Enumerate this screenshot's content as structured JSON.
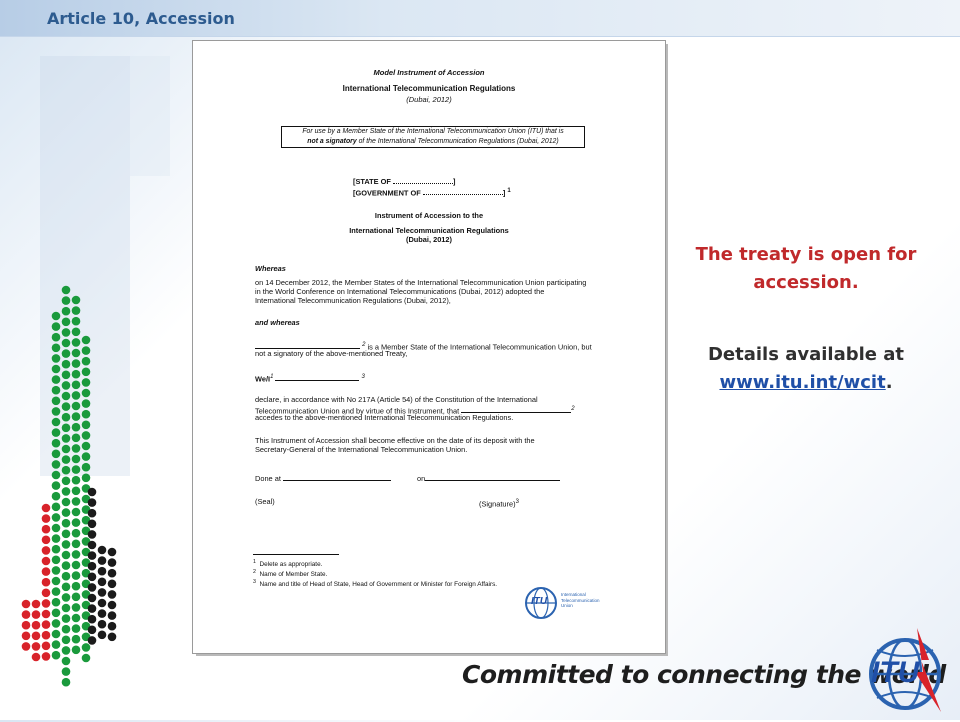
{
  "slide": {
    "title": "Article 10, Accession"
  },
  "document": {
    "heading1": "Model Instrument of Accession",
    "heading2": "International Telecommunication Regulations",
    "heading2_sub": "(Dubai, 2012)",
    "box_line1": "For use by a Member State of the International Telecommunication Union (ITU) that is",
    "box_line2_bold": "not a signatory",
    "box_line2_rest": " of the International Telecommunication Regulations (Dubai, 2012)",
    "state_of": "[STATE OF",
    "state_of_end": "]",
    "government_of": "[GOVERNMENT OF",
    "government_of_end": "]",
    "sup1": "1",
    "instrument_title1": "Instrument of Accession to the",
    "instrument_title2": "International Telecommunication Regulations",
    "instrument_title3": "(Dubai, 2012)",
    "whereas": "Whereas",
    "whereas_text1": "on 14 December 2012, the Member States of the International Telecommunication Union participating",
    "whereas_text2": "in the World Conference on International Telecommunications (Dubai, 2012) adopted  the",
    "whereas_text3": "International Telecommunication Regulations (Dubai, 2012),",
    "and_whereas": "and whereas",
    "member_state_sup": "2",
    "member_state_text": " is a Member State of the International Telecommunication Union, but",
    "member_state_text2": "not a signatory of the above-mentioned Treaty,",
    "we_i": "We/I",
    "we_i_sup": "1",
    "we_i_sup3": "3",
    "declare1": "declare, in accordance with No 217A (Article 54) of the Constitution of the International",
    "declare2": "Telecommunication Union and by virtue of this Instrument, that",
    "declare2_sup": "2",
    "declare3": "accedes to the above-mentioned International Telecommunication Regulations.",
    "effective1": "This Instrument of Accession shall become effective on the date of its deposit with the",
    "effective2": "Secretary-General of the International Telecommunication Union.",
    "done_at": "Done at",
    "on": "on",
    "seal": "(Seal)",
    "signature": "(Signature)",
    "signature_sup": "3",
    "footnotes": [
      {
        "num": "1",
        "text": "Delete as appropriate."
      },
      {
        "num": "2",
        "text": "Name of Member State."
      },
      {
        "num": "3",
        "text": "Name and title of Head of State, Head of Government or Minister for Foreign Affairs."
      }
    ],
    "logo_text": "ITU",
    "logo_caption1": "International",
    "logo_caption2": "Telecommunication",
    "logo_caption3": "Union"
  },
  "right_panel": {
    "statement": "The treaty is open for accession.",
    "details_prefix": "Details available at",
    "details_link": "www.itu.int/wcit",
    "details_suffix": "."
  },
  "footer": {
    "slogan": "Committed to connecting the world",
    "logo_text": "ITU"
  },
  "colors": {
    "accent_red": "#c0292b",
    "title_blue": "#2d5b8f",
    "link_blue": "#1f4fa7",
    "flag_green": "#1a9a3c",
    "flag_black": "#1b1b1b",
    "flag_red": "#d8232a"
  }
}
